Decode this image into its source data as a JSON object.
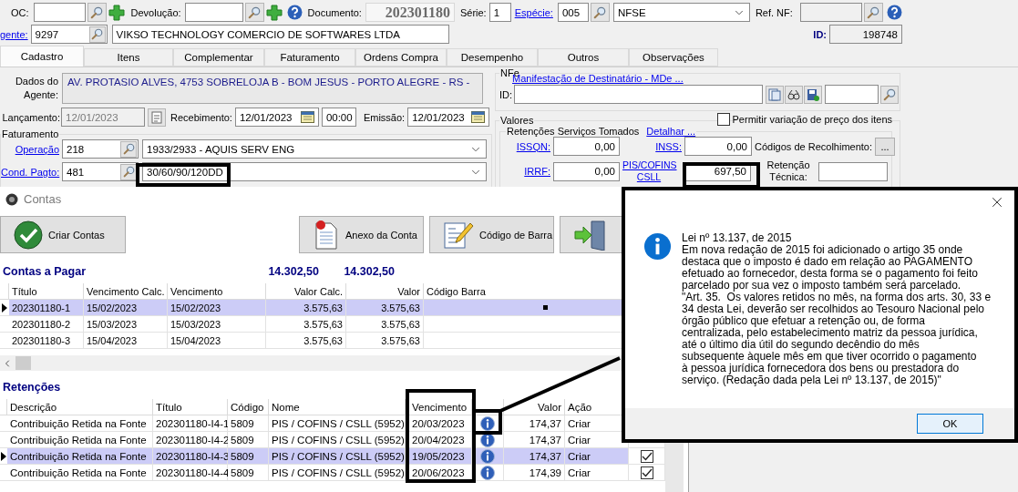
{
  "top_bar": {
    "oc_label": "OC:",
    "devolucao_label": "Devolução:",
    "documento_label": "Documento:",
    "documento": "202301180",
    "serie_label": "Série:",
    "serie": "1",
    "especie_label": "Espécie:",
    "especie_code": "005",
    "especie_name": "NFSE",
    "ref_nf_label": "Ref. NF:"
  },
  "agent": {
    "label": "gente:",
    "code": "9297",
    "name": "VIKSO TECHNOLOGY COMERCIO DE SOFTWARES LTDA",
    "id_label": "ID:",
    "id": "198748"
  },
  "tabs": [
    {
      "label": "Cadastro",
      "selected": true
    },
    {
      "label": "Itens",
      "selected": false
    },
    {
      "label": "Complementar",
      "selected": false
    },
    {
      "label": "Faturamento",
      "selected": false
    },
    {
      "label": "Ordens Compra",
      "selected": false
    },
    {
      "label": "Desempenho",
      "selected": false
    },
    {
      "label": "Outros",
      "selected": false
    },
    {
      "label": "Observações",
      "selected": false
    }
  ],
  "cadastro": {
    "dados_label": "Dados do Agente:",
    "address": "AV. PROTASIO ALVES, 4753 SOBRELOJA B - BOM JESUS - PORTO ALEGRE - RS -",
    "lancamento_label": "Lançamento:",
    "lancamento": "12/01/2023",
    "recebimento_label": "Recebimento:",
    "recebimento": "12/01/2023",
    "hora": "00:00",
    "emissao_label": "Emissão:",
    "emissao": "12/01/2023",
    "faturamento_title": "Faturamento",
    "operacao_label": "Operação",
    "operacao_code": "218",
    "operacao_name": "1933/2933 - AQUIS SERV ENG",
    "cond_label": "Cond. Pagto:",
    "cond_code": "481",
    "cond_name": "30/60/90/120DD"
  },
  "nfe": {
    "title": "NFe",
    "mde_link": "Manifestação de Destinatário - MDe ...",
    "id_label": "ID:"
  },
  "valores": {
    "title": "Valores",
    "permitir_label": "Permitir variação de preço dos itens",
    "permitir_checked": false,
    "retencoes_title": "Retenções Serviços Tomados",
    "detalhar_link": "Detalhar ...",
    "issqn_label": "ISSQN:",
    "issqn": "0,00",
    "inss_label": "INSS:",
    "inss": "0,00",
    "codigos_label": "Códigos de Recolhimento:",
    "codigos_button": "...",
    "irrf_label": "IRRF:",
    "irrf": "0,00",
    "pis_label": "PIS/COFINS CSLL",
    "pis": "697,50",
    "retencao_label": "Retenção Técnica:"
  },
  "contas_window": {
    "title": "Contas",
    "buttons": [
      {
        "kind": "create",
        "label": "Criar Contas"
      },
      {
        "kind": "attachment",
        "label": "Anexo da Conta"
      },
      {
        "kind": "barcode",
        "label": "Código de Barra"
      },
      {
        "kind": "exit"
      }
    ],
    "payables": {
      "title": "Contas a Pagar",
      "total_calc": "14.302,50",
      "total": "14.302,50",
      "columns": [
        "Título",
        "Vencimento Calc.",
        "Vencimento",
        "Valor Calc.",
        "Valor",
        "Código Barra"
      ],
      "rows": [
        {
          "cells": [
            "202301180-1",
            "15/02/2023",
            "15/02/2023",
            "3.575,63",
            "3.575,63"
          ],
          "selected": true
        },
        {
          "cells": [
            "202301180-2",
            "15/03/2023",
            "15/03/2023",
            "3.575,63",
            "3.575,63"
          ],
          "selected": false
        },
        {
          "cells": [
            "202301180-3",
            "15/04/2023",
            "15/04/2023",
            "3.575,63",
            "3.575,63"
          ],
          "selected": false
        }
      ]
    },
    "retentions": {
      "title": "Retenções",
      "columns": [
        "Descrição",
        "Título",
        "Código",
        "Nome",
        "Vencimento",
        "Valor",
        "Ação"
      ],
      "rows": [
        {
          "descricao": "Contribuição Retida na Fonte",
          "titulo": "202301180-I4-1",
          "codigo": "5809",
          "nome": "PIS / COFINS / CSLL (5952)",
          "vencimento": "20/03/2023",
          "valor": "174,37",
          "acao": "Criar",
          "selected": false
        },
        {
          "descricao": "Contribuição Retida na Fonte",
          "titulo": "202301180-I4-2",
          "codigo": "5809",
          "nome": "PIS / COFINS / CSLL (5952)",
          "vencimento": "20/04/2023",
          "valor": "174,37",
          "acao": "Criar",
          "selected": false
        },
        {
          "descricao": "Contribuição Retida na Fonte",
          "titulo": "202301180-I4-3",
          "codigo": "5809",
          "nome": "PIS / COFINS / CSLL (5952)",
          "vencimento": "19/05/2023",
          "valor": "174,37",
          "acao": "Criar",
          "selected": true,
          "checked": true
        },
        {
          "descricao": "Contribuição Retida na Fonte",
          "titulo": "202301180-I4-4",
          "codigo": "5809",
          "nome": "PIS / COFINS / CSLL (5952)",
          "vencimento": "20/06/2023",
          "valor": "174,39",
          "acao": "Criar",
          "selected": false,
          "checked": true
        }
      ]
    }
  },
  "dialog": {
    "message": "Lei nº 13.137, de 2015\nEm nova redação de 2015 foi adicionado o artigo 35 onde\ndestaca que o imposto é dado em relação ao PAGAMENTO\nefetuado ao fornecedor, desta forma se o pagamento foi feito\nparcelado por sua vez o imposto também será parcelado.\n\"Art. 35.  Os valores retidos no mês, na forma dos arts. 30, 33 e\n34 desta Lei, deverão ser recolhidos ao Tesouro Nacional pelo\nórgão público que efetuar a retenção ou, de forma\ncentralizada, pelo estabelecimento matriz da pessoa jurídica,\naté o último dia útil do segundo decêndio do mês\nsubsequente àquele mês em que tiver ocorrido o pagamento\nà pessoa jurídica fornecedora dos bens ou prestadora do\nserviço. (Redação dada pela Lei nº 13.137, de 2015)\"",
    "ok": "OK"
  }
}
